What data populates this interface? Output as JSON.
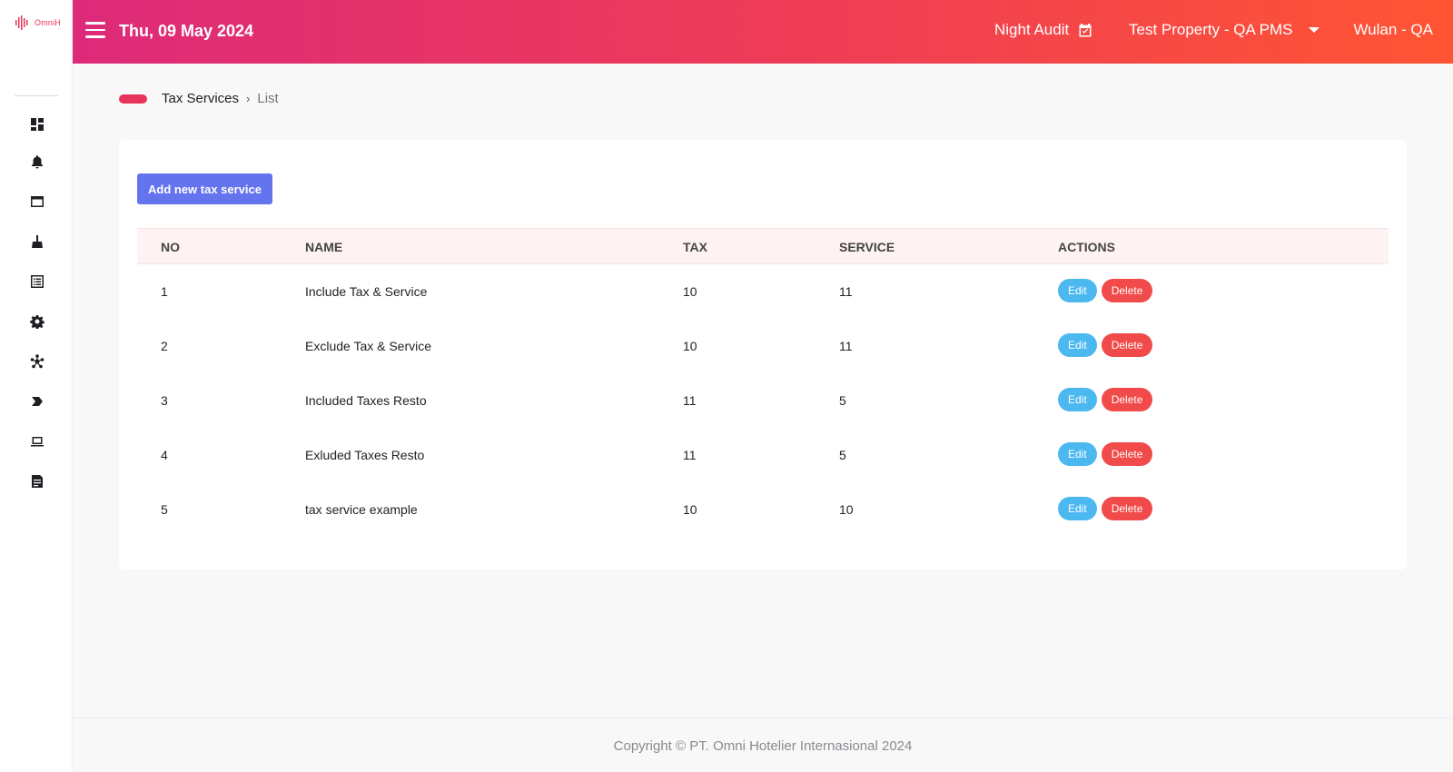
{
  "brand": {
    "logo_text": "OmniH",
    "accent": "#e8335a"
  },
  "header": {
    "date": "Thu, 09 May 2024",
    "night_audit_label": "Night Audit",
    "property_label": "Test Property - QA PMS",
    "user_label": "Wulan - QA",
    "gradient": [
      "#dd2a79",
      "#ff5533"
    ]
  },
  "sidebar": {
    "items": [
      {
        "icon": "dashboard-icon"
      },
      {
        "icon": "bell-icon"
      },
      {
        "icon": "window-icon"
      },
      {
        "icon": "broom-icon"
      },
      {
        "icon": "list-icon"
      },
      {
        "icon": "gear-icon"
      },
      {
        "icon": "hub-icon"
      },
      {
        "icon": "chevron-tag-icon"
      },
      {
        "icon": "laptop-icon"
      },
      {
        "icon": "report-icon"
      }
    ]
  },
  "breadcrumb": {
    "main": "Tax Services",
    "separator": "›",
    "current": "List"
  },
  "page": {
    "add_button_label": "Add new tax service"
  },
  "table": {
    "columns": [
      "NO",
      "NAME",
      "TAX",
      "SERVICE",
      "ACTIONS"
    ],
    "rows": [
      {
        "no": "1",
        "name": "Include Tax & Service",
        "tax": "10",
        "service": "11"
      },
      {
        "no": "2",
        "name": "Exclude Tax & Service",
        "tax": "10",
        "service": "11"
      },
      {
        "no": "3",
        "name": "Included Taxes Resto",
        "tax": "11",
        "service": "5"
      },
      {
        "no": "4",
        "name": "Exluded Taxes Resto",
        "tax": "11",
        "service": "5"
      },
      {
        "no": "5",
        "name": "tax service example",
        "tax": "10",
        "service": "10"
      }
    ],
    "edit_label": "Edit",
    "delete_label": "Delete"
  },
  "footer": {
    "copyright": "Copyright © PT. Omni Hotelier Internasional 2024"
  }
}
